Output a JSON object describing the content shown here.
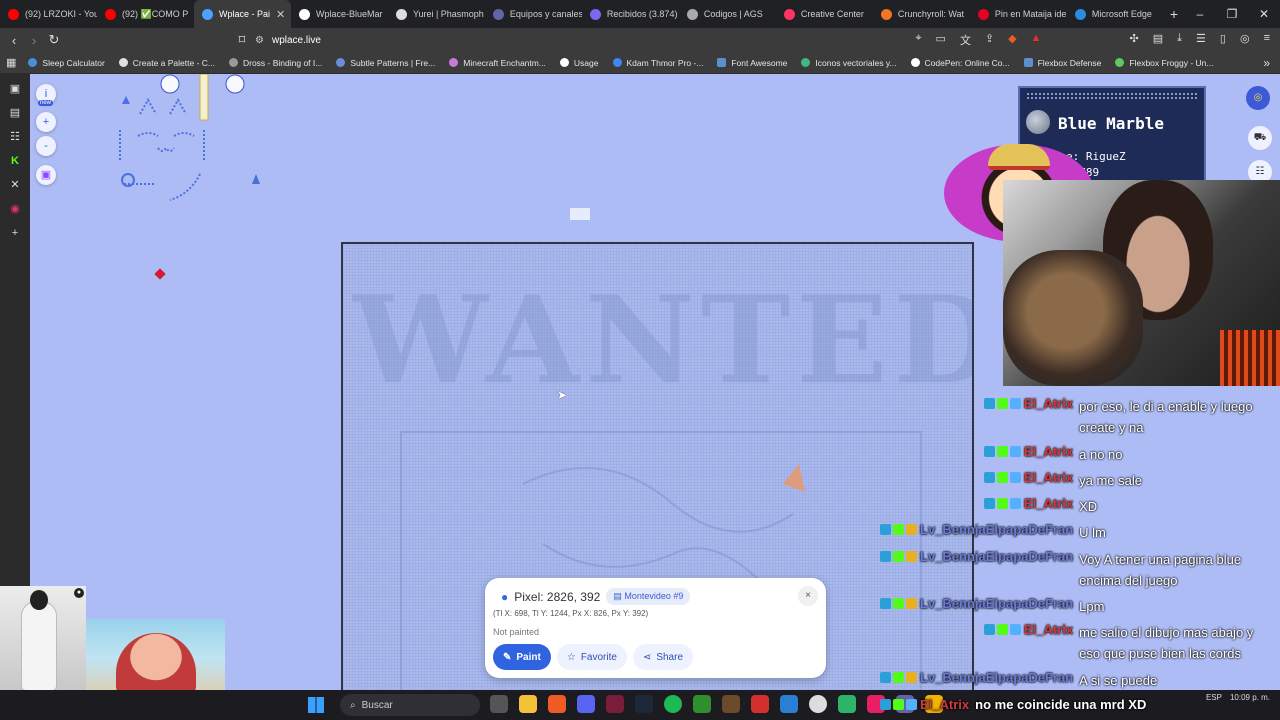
{
  "browser": {
    "tabs": [
      {
        "label": "(92) LRZOKI - You",
        "color": "#ff0000"
      },
      {
        "label": "(92) ✅COMO P",
        "color": "#ff0000"
      },
      {
        "label": "Wplace - Pai",
        "color": "#4aa3ff",
        "active": true
      },
      {
        "label": "Wplace-BlueMar",
        "color": "#ffffff"
      },
      {
        "label": "Yurei | Phasmoph",
        "color": "#dddddd"
      },
      {
        "label": "Equipos y canales",
        "color": "#6264a7"
      },
      {
        "label": "Recibidos (3.874)",
        "color": "#7b68ee"
      },
      {
        "label": "Codigos | AGS",
        "color": "#aaaaaa"
      },
      {
        "label": "Creative Center",
        "color": "#ff3366"
      },
      {
        "label": "Crunchyroll: Wat",
        "color": "#f47521"
      },
      {
        "label": "Pin en Mataija ide",
        "color": "#e60023"
      },
      {
        "label": "Microsoft Edge",
        "color": "#2a8be0"
      }
    ],
    "new_tab": "+",
    "url": "wplace.live",
    "bookmarks": [
      "Sleep Calculator",
      "Create a Palette - C...",
      "Dross - Binding of I...",
      "Subtle Patterns | Fre...",
      "Minecraft Enchantm...",
      "Usage",
      "Kdam Thmor Pro -...",
      "Font Awesome",
      "Iconos vectoriales y...",
      "CodePen: Online Co...",
      "Flexbox Defense",
      "Flexbox Froggy - Un..."
    ]
  },
  "map_controls": {
    "info": "i",
    "new_badge": "new",
    "zoom_in": "+",
    "zoom_out": "-"
  },
  "canvas": {
    "watermark_text": "WANTED"
  },
  "pixel_card": {
    "title": "Pixel: 2826, 392",
    "region": "Montevideo #9",
    "coords": "(Tl X: 698, Tl Y: 1244, Px X: 826, Px Y: 392)",
    "status": "Not painted",
    "paint": "Paint",
    "favorite": "Favorite",
    "share": "Share",
    "close": "×"
  },
  "blue_marble": {
    "title": "Blue Marble",
    "username_line": "e: RigueZ",
    "number_line": ": 789"
  },
  "chat": [
    {
      "user": "El_Atrix",
      "color": "#d23a3a",
      "text": [
        "por eso, le di a enable y luego",
        "create y na"
      ]
    },
    {
      "user": "El_Atrix",
      "color": "#d23a3a",
      "text": [
        "a no no"
      ]
    },
    {
      "user": "El_Atrix",
      "color": "#d23a3a",
      "text": [
        "ya me sale"
      ]
    },
    {
      "user": "El_Atrix",
      "color": "#d23a3a",
      "text": [
        "XD"
      ]
    },
    {
      "user": "Lv_BennjaElpapaDeFran",
      "color": "#6a7bd8",
      "text": [
        "U lm"
      ]
    },
    {
      "user": "Lv_BennjaElpapaDeFran",
      "color": "#6a7bd8",
      "text": [
        "Voy A tener una pagina blue",
        "encima del juego"
      ]
    },
    {
      "user": "Lv_BennjaElpapaDeFran",
      "color": "#6a7bd8",
      "text": [
        "Lpm"
      ]
    },
    {
      "user": "El_Atrix",
      "color": "#d23a3a",
      "text": [
        "me salio el dibujo mas abajo y",
        "eso que puse bien las cords"
      ]
    },
    {
      "user": "Lv_BennjaElpapaDeFran",
      "color": "#6a7bd8",
      "text": [
        "A si se puede"
      ]
    },
    {
      "user": "El_Atrix",
      "color": "#d23a3a",
      "text": [
        "no me coincide una mrd XD"
      ]
    }
  ],
  "taskbar": {
    "search_placeholder": "Buscar",
    "language": "ESP",
    "time": "10:09 p. m."
  },
  "colors": {
    "canvas": "#aebcf5",
    "accent": "#2f63e0",
    "chat_red": "#d23a3a",
    "chat_blue": "#6a7bd8"
  }
}
